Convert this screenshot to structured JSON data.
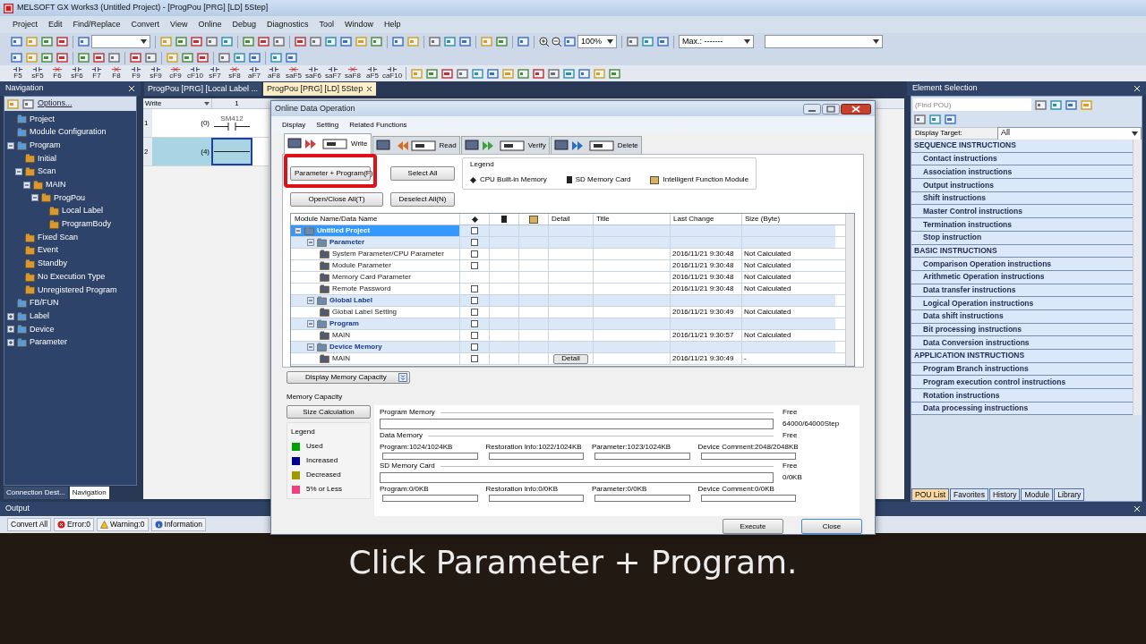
{
  "window": {
    "title": "MELSOFT GX Works3 (Untitled Project) - [ProgPou [PRG] [LD] 5Step]"
  },
  "menu": [
    "Project",
    "Edit",
    "Find/Replace",
    "Convert",
    "View",
    "Online",
    "Debug",
    "Diagnostics",
    "Tool",
    "Window",
    "Help"
  ],
  "toolbar": {
    "zoom": "100%",
    "max_field": "Max.: -------",
    "function_keys": [
      "F5",
      "sF5",
      "F6",
      "sF6",
      "F7",
      "F8",
      "F9",
      "sF9",
      "cF9",
      "cF10",
      "sF7",
      "sF8",
      "aF7",
      "aF8",
      "saF5",
      "saF6",
      "saF7",
      "saF8",
      "aF5",
      "caF10"
    ]
  },
  "navigation": {
    "title": "Navigation",
    "options": "Options...",
    "tree": [
      {
        "label": "Project"
      },
      {
        "label": "Module Configuration"
      },
      {
        "label": "Program",
        "expanded": true,
        "children": [
          {
            "label": "Initial"
          },
          {
            "label": "Scan",
            "expanded": true,
            "children": [
              {
                "label": "MAIN",
                "expanded": true,
                "children": [
                  {
                    "label": "ProgPou",
                    "expanded": true,
                    "children": [
                      {
                        "label": "Local Label"
                      },
                      {
                        "label": "ProgramBody"
                      }
                    ]
                  }
                ]
              }
            ]
          },
          {
            "label": "Fixed Scan"
          },
          {
            "label": "Event"
          },
          {
            "label": "Standby"
          },
          {
            "label": "No Execution Type"
          },
          {
            "label": "Unregistered Program"
          }
        ]
      },
      {
        "label": "FB/FUN"
      },
      {
        "label": "Label",
        "expanded": false
      },
      {
        "label": "Device",
        "expanded": false
      },
      {
        "label": "Parameter",
        "expanded": false
      }
    ],
    "bottom_tabs": [
      {
        "label": "Connection Dest...",
        "selected": false
      },
      {
        "label": "Navigation",
        "selected": true
      }
    ]
  },
  "editor_tabs": [
    {
      "label": "ProgPou [PRG] [Local Label ...",
      "selected": false
    },
    {
      "label": "ProgPou [PRG] [LD] 5Step",
      "selected": true
    }
  ],
  "ladder": {
    "mode": "Write",
    "column": "1",
    "rows": [
      {
        "number": "1",
        "step": "(0)",
        "device": "SM412",
        "selected": false
      },
      {
        "number": "2",
        "step": "(4)",
        "selected": true
      }
    ]
  },
  "dialog": {
    "title": "Online Data Operation",
    "menu": [
      "Display",
      "Setting",
      "Related Functions"
    ],
    "tabs": [
      {
        "label": "Write",
        "selected": true
      },
      {
        "label": "Read",
        "selected": false
      },
      {
        "label": "Verify",
        "selected": false
      },
      {
        "label": "Delete",
        "selected": false
      }
    ],
    "buttons": [
      {
        "label": "Parameter + Program(F)",
        "highlighted": true
      },
      {
        "label": "Select All",
        "highlighted": false
      },
      {
        "label": "Open/Close All(T)",
        "highlighted": false
      },
      {
        "label": "Deselect All(N)",
        "highlighted": false
      }
    ],
    "legend": {
      "title": "Legend",
      "items": [
        "CPU Built-in Memory",
        "SD Memory Card",
        "Intelligent Function Module"
      ]
    },
    "table": {
      "columns": [
        "Module Name/Data Name",
        "Detail",
        "Title",
        "Last Change",
        "Size (Byte)"
      ],
      "rows": [
        {
          "name": "Untitled Project",
          "kind": "project",
          "selected": true,
          "expanded": true,
          "checked": false,
          "children": [
            {
              "name": "Parameter",
              "kind": "group",
              "selected": false,
              "expanded": true,
              "checked": false,
              "children": [
                {
                  "name": "System Parameter/CPU Parameter",
                  "kind": "item",
                  "selected": false,
                  "checked": false,
                  "last_change": "2016/11/21 9:30:48",
                  "size": "Not Calculated"
                },
                {
                  "name": "Module Parameter",
                  "kind": "item",
                  "selected": false,
                  "checked": false,
                  "last_change": "2016/11/21 9:30:48",
                  "size": "Not Calculated"
                },
                {
                  "name": "Memory Card Parameter",
                  "kind": "item",
                  "selected": false,
                  "last_change": "2016/11/21 9:30:48",
                  "size": "Not Calculated"
                },
                {
                  "name": "Remote Password",
                  "kind": "item",
                  "selected": false,
                  "checked": false,
                  "last_change": "2016/11/21 9:30:48",
                  "size": "Not Calculated"
                }
              ]
            },
            {
              "name": "Global Label",
              "kind": "group",
              "selected": false,
              "expanded": true,
              "checked": false,
              "children": [
                {
                  "name": "Global Label Setting",
                  "kind": "item",
                  "selected": false,
                  "checked": false,
                  "last_change": "2016/11/21 9:30:49",
                  "size": "Not Calculated"
                }
              ]
            },
            {
              "name": "Program",
              "kind": "group",
              "selected": false,
              "expanded": true,
              "checked": false,
              "children": [
                {
                  "name": "MAIN",
                  "kind": "item",
                  "selected": false,
                  "checked": false,
                  "last_change": "2016/11/21 9:30:57",
                  "size": "Not Calculated"
                }
              ]
            },
            {
              "name": "Device Memory",
              "kind": "group",
              "selected": false,
              "expanded": true,
              "checked": false,
              "children": [
                {
                  "name": "MAIN",
                  "kind": "item",
                  "selected": false,
                  "checked": false,
                  "detail": "Detail",
                  "last_change": "2016/11/21 9:30:49",
                  "size": "-"
                }
              ]
            }
          ]
        }
      ]
    },
    "memory_toggle": "Display Memory Capacity",
    "memory_title": "Memory Capacity",
    "size_calculation": "Size Calculation",
    "memory_legend": {
      "title": "Legend",
      "items": [
        {
          "label": "Used",
          "color": "#00a000"
        },
        {
          "label": "Increased",
          "color": "#000090"
        },
        {
          "label": "Decreased",
          "color": "#a09800"
        },
        {
          "label": "5% or Less",
          "color": "#f04080"
        }
      ]
    },
    "memory_sections": [
      {
        "title": "Program Memory",
        "free_label": "Free",
        "free": "64000/64000Step"
      },
      {
        "title": "Data Memory",
        "free_label": "Free",
        "parts": [
          "Program:1024/1024KB",
          "Restoration Info:1022/1024KB",
          "Parameter:1023/1024KB",
          "Device Comment:2048/2048KB"
        ]
      },
      {
        "title": "SD Memory Card",
        "free_label": "Free",
        "free": "0/0KB",
        "parts": [
          "Program:0/0KB",
          "Restoration Info:0/0KB",
          "Parameter:0/0KB",
          "Device Comment:0/0KB"
        ]
      }
    ],
    "footer_buttons": [
      "Execute",
      "Close"
    ]
  },
  "element_selection": {
    "title": "Element Selection",
    "search": {
      "placeholder": "(Find POU)"
    },
    "target_label": "Display Target:",
    "target": "All",
    "items": [
      {
        "label": "SEQUENCE INSTRUCTIONS",
        "kind": "header"
      },
      {
        "label": "Contact instructions",
        "kind": "item"
      },
      {
        "label": "Association instructions",
        "kind": "item"
      },
      {
        "label": "Output instructions",
        "kind": "item"
      },
      {
        "label": "Shift instructions",
        "kind": "item"
      },
      {
        "label": "Master Control instructions",
        "kind": "item"
      },
      {
        "label": "Termination instructions",
        "kind": "item"
      },
      {
        "label": "Stop instruction",
        "kind": "item"
      },
      {
        "label": "BASIC INSTRUCTIONS",
        "kind": "header"
      },
      {
        "label": "Comparison Operation instructions",
        "kind": "item"
      },
      {
        "label": "Arithmetic Operation instructions",
        "kind": "item"
      },
      {
        "label": "Data transfer instructions",
        "kind": "item"
      },
      {
        "label": "Logical Operation instructions",
        "kind": "item"
      },
      {
        "label": "Data shift instructions",
        "kind": "item"
      },
      {
        "label": "Bit processing instructions",
        "kind": "item"
      },
      {
        "label": "Data Conversion instructions",
        "kind": "item"
      },
      {
        "label": "APPLICATION INSTRUCTIONS",
        "kind": "header"
      },
      {
        "label": "Program Branch instructions",
        "kind": "item"
      },
      {
        "label": "Program execution control instructions",
        "kind": "item"
      },
      {
        "label": "Rotation instructions",
        "kind": "item"
      },
      {
        "label": "Data processing instructions",
        "kind": "item"
      }
    ],
    "tabs": [
      {
        "label": "POU List",
        "selected": true
      },
      {
        "label": "Favorites",
        "selected": false
      },
      {
        "label": "History",
        "selected": false
      },
      {
        "label": "Module",
        "selected": false
      },
      {
        "label": "Library",
        "selected": false
      }
    ]
  },
  "output": {
    "title": "Output",
    "buttons": [
      {
        "label": "Convert All",
        "kind": "plain"
      },
      {
        "label": "Error:0",
        "kind": "error"
      },
      {
        "label": "Warning:0",
        "kind": "warning"
      },
      {
        "label": "Information",
        "kind": "info"
      }
    ]
  },
  "caption": "Click Parameter + Program."
}
